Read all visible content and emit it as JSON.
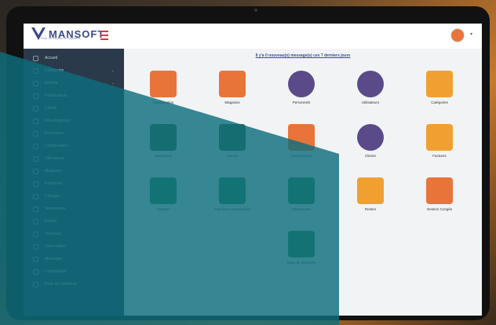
{
  "app": {
    "brand": "MANSOFT",
    "tagline": "Pour un monde de Solutions"
  },
  "header": {
    "message": "Il y'a 0 nouveau(x) message(s) ces 7 derniers jours"
  },
  "sidebar": {
    "items": [
      {
        "label": "Accueil",
        "icon": "home-icon"
      },
      {
        "label": "Categories",
        "icon": "tag-icon"
      },
      {
        "label": "Articles",
        "icon": "book-icon"
      },
      {
        "label": "Fournisseurs",
        "icon": "truck-icon"
      },
      {
        "label": "Clients",
        "icon": "user-icon"
      },
      {
        "label": "Intra Magasins",
        "icon": "swap-icon"
      },
      {
        "label": "Inventaires",
        "icon": "clipboard-icon"
      },
      {
        "label": "Configuration",
        "icon": "gear-icon"
      },
      {
        "label": "Utilisateurs",
        "icon": "users-icon"
      },
      {
        "label": "Magasins",
        "icon": "store-icon"
      },
      {
        "label": "Personnel",
        "icon": "id-icon"
      },
      {
        "label": "Charges",
        "icon": "wallet-icon"
      },
      {
        "label": "Versements",
        "icon": "money-icon"
      },
      {
        "label": "Restes",
        "icon": "file-icon"
      },
      {
        "label": "Tranches",
        "icon": "clock-icon"
      },
      {
        "label": "Observation",
        "icon": "search-icon"
      },
      {
        "label": "Messages",
        "icon": "mail-icon"
      },
      {
        "label": "Comptabilité",
        "icon": "calc-icon"
      },
      {
        "label": "Etats de Synthèse",
        "icon": "chart-icon"
      }
    ]
  },
  "tiles": [
    {
      "label": "Configuration",
      "icon": "settings-monitor-icon"
    },
    {
      "label": "Magasins",
      "icon": "store-icon"
    },
    {
      "label": "Personnels",
      "icon": "staff-icon"
    },
    {
      "label": "Utilisateurs",
      "icon": "users-icon"
    },
    {
      "label": "Catégories",
      "icon": "categories-icon"
    },
    {
      "label": "Inventaires",
      "icon": "inventory-icon"
    },
    {
      "label": "Articles",
      "icon": "shopping-bag-icon"
    },
    {
      "label": "Fournisseurs",
      "icon": "delivery-truck-icon"
    },
    {
      "label": "Clients",
      "icon": "client-hand-icon"
    },
    {
      "label": "Factures",
      "icon": "invoice-icon"
    },
    {
      "label": "Charges",
      "icon": "wallet-icon"
    },
    {
      "label": "Tranches Commissions",
      "icon": "commission-icon"
    },
    {
      "label": "Versements",
      "icon": "cash-transfer-icon"
    },
    {
      "label": "Restes",
      "icon": "coins-icon"
    },
    {
      "label": "Gestion Congés",
      "icon": "calendar-icon"
    },
    {
      "label": "Etats de Synthèse",
      "icon": "bar-chart-icon"
    }
  ],
  "colors": {
    "overlay": "#0d6e7e",
    "sidebar": "#2b3a4a",
    "brand": "#3a4a8a",
    "accent": "#e8743a"
  }
}
